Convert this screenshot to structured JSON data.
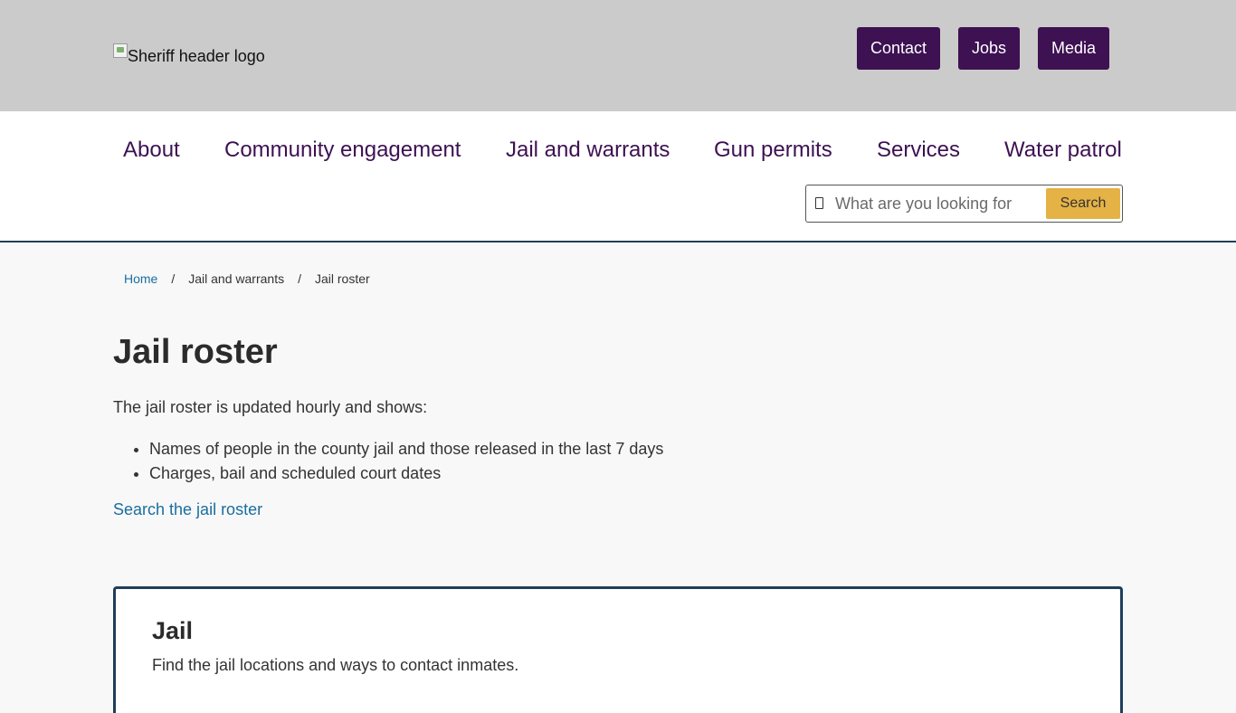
{
  "header": {
    "logo_alt": "Sheriff header logo",
    "buttons": {
      "contact": "Contact",
      "jobs": "Jobs",
      "media": "Media"
    }
  },
  "nav": {
    "items": [
      "About",
      "Community engagement",
      "Jail and warrants",
      "Gun permits",
      "Services",
      "Water patrol"
    ]
  },
  "search": {
    "placeholder": "What are you looking for",
    "button": "Search",
    "icon": "search-icon"
  },
  "breadcrumb": {
    "home": "Home",
    "separator": "/",
    "parent": "Jail and warrants",
    "current": "Jail roster"
  },
  "main": {
    "title": "Jail roster",
    "intro": "The jail roster is updated hourly and shows:",
    "bullets": [
      "Names of people in the county jail and those released in the last 7 days",
      "Charges, bail and scheduled court dates"
    ],
    "link": "Search the jail roster"
  },
  "card": {
    "title": "Jail",
    "description": "Find the jail locations and ways to contact inmates."
  },
  "colors": {
    "header_bg": "#cbcbcb",
    "brand_purple": "#3d1152",
    "accent_gold": "#e5b246",
    "link_blue": "#1a6ea0",
    "border_navy": "#1f3e5a"
  }
}
